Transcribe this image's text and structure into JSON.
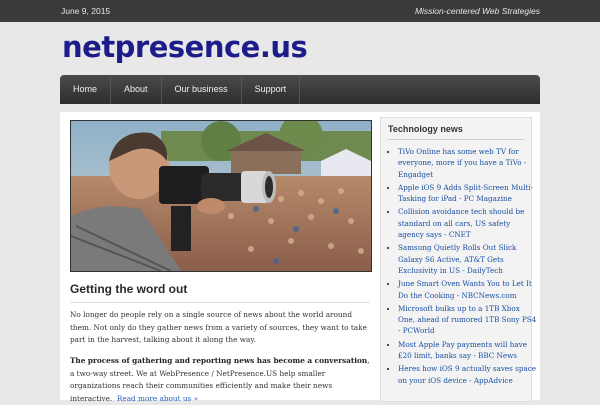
{
  "topbar": {
    "date": "June 9, 2015",
    "tagline": "Mission-centered Web Strategies"
  },
  "logo": {
    "text": "netpresence.us"
  },
  "nav": {
    "items": [
      "Home",
      "About",
      "Our business",
      "Support"
    ]
  },
  "hero": {
    "alt": "Photographer at a crowded event"
  },
  "post": {
    "title": "Getting the word out",
    "para1": "No longer do people rely on a single source of news about the world around them. Not only do they gather news from a variety of sources, they want to take part in the harvest, talking about it along the way.",
    "para2_bold": "The process of gathering and reporting news has become a conversation",
    "para2_rest": ", a two-way street. We at WebPresence / NetPresence.US help smaller organizations reach their communities efficiently and make their news interactive.",
    "read_more": "Read more about us »"
  },
  "sidebar": {
    "title": "Technology news",
    "items": [
      "TiVo Online has some web TV for everyone, more if you have a TiVo - Engadget",
      "Apple iOS 9 Adds Split-Screen Multi-Tasking for iPad - PC Magazine",
      "Collision avoidance tech should be standard on all cars, US safety agency says - CNET",
      "Samsung Quietly Rolls Out Slick Galaxy S6 Active, AT&T Gets Exclusivity in US - DailyTech",
      "June Smart Oven Wants You to Let It Do the Cooking - NBCNews.com",
      "Microsoft bulks up to a 1TB Xbox One, ahead of rumored 1TB Sony PS4 - PCWorld",
      "Most Apple Pay payments will have £20 limit, banks say - BBC News",
      "Heres how iOS 9 actually saves space on your iOS device - AppAdvice"
    ]
  },
  "colors": {
    "logo": "#1c1c8a",
    "topbar": "#3a3a3a",
    "nav": "#3a3a3a",
    "link": "#1a4fa3"
  }
}
